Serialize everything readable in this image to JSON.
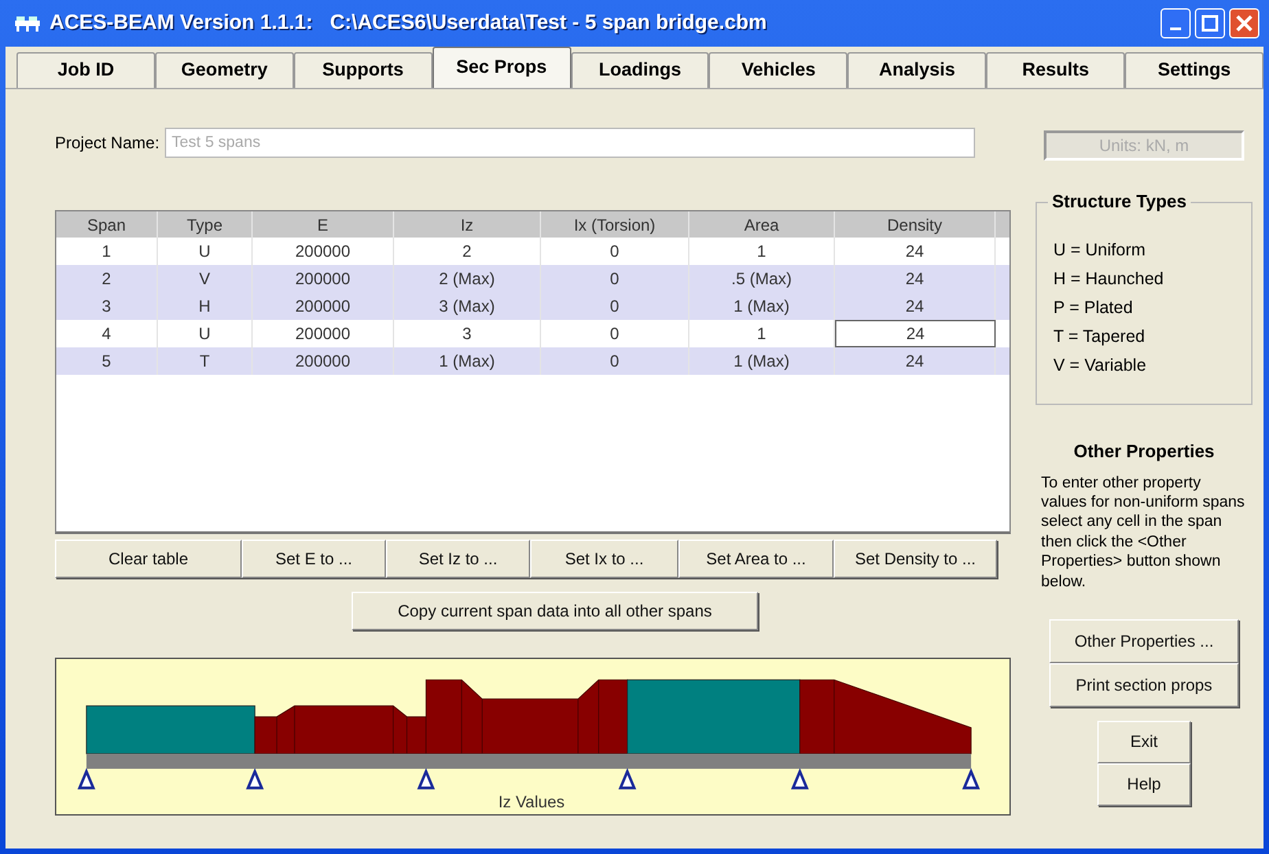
{
  "window": {
    "title": "ACES-BEAM Version 1.1.1:   C:\\ACES6\\Userdata\\Test - 5 span bridge.cbm"
  },
  "tabs": [
    {
      "label": "Job ID",
      "selected": false
    },
    {
      "label": "Geometry",
      "selected": false
    },
    {
      "label": "Supports",
      "selected": false
    },
    {
      "label": "Sec Props",
      "selected": true
    },
    {
      "label": "Loadings",
      "selected": false
    },
    {
      "label": "Vehicles",
      "selected": false
    },
    {
      "label": "Analysis",
      "selected": false
    },
    {
      "label": "Results",
      "selected": false
    },
    {
      "label": "Settings",
      "selected": false
    }
  ],
  "project": {
    "label": "Project Name:",
    "value": "Test 5 spans"
  },
  "units": "Units: kN, m",
  "table": {
    "columns": [
      "Span",
      "Type",
      "E",
      "Iz",
      "Ix (Torsion)",
      "Area",
      "Density"
    ],
    "rows": [
      {
        "cells": [
          "1",
          "U",
          "200000",
          "2",
          "0",
          "1",
          "24"
        ],
        "shaded": false,
        "current": false
      },
      {
        "cells": [
          "2",
          "V",
          "200000",
          "2 (Max)",
          "0",
          ".5 (Max)",
          "24"
        ],
        "shaded": true,
        "current": false
      },
      {
        "cells": [
          "3",
          "H",
          "200000",
          "3 (Max)",
          "0",
          "1 (Max)",
          "24"
        ],
        "shaded": true,
        "current": false
      },
      {
        "cells": [
          "4",
          "U",
          "200000",
          "3",
          "0",
          "1",
          "24"
        ],
        "shaded": false,
        "current": true
      },
      {
        "cells": [
          "5",
          "T",
          "200000",
          "1 (Max)",
          "0",
          "1 (Max)",
          "24"
        ],
        "shaded": true,
        "current": false
      }
    ]
  },
  "table_buttons": [
    "Clear table",
    "Set E to ...",
    "Set Iz to ...",
    "Set Ix to ...",
    "Set Area to ...",
    "Set Density to ..."
  ],
  "copy_button": "Copy current span data into all other spans",
  "diagram": {
    "caption": "Iz Values"
  },
  "structure_types": {
    "title": "Structure Types",
    "items": [
      "U = Uniform",
      "H = Haunched",
      "P = Plated",
      "T = Tapered",
      "V = Variable"
    ]
  },
  "other_properties": {
    "title": "Other Properties",
    "text": "To enter other property values for non-uniform spans select any cell in the span then click the <Other Properties> button shown below."
  },
  "side_buttons": [
    "Other Properties ...",
    "Print section props"
  ],
  "bottom_buttons": [
    "Exit",
    "Help"
  ]
}
